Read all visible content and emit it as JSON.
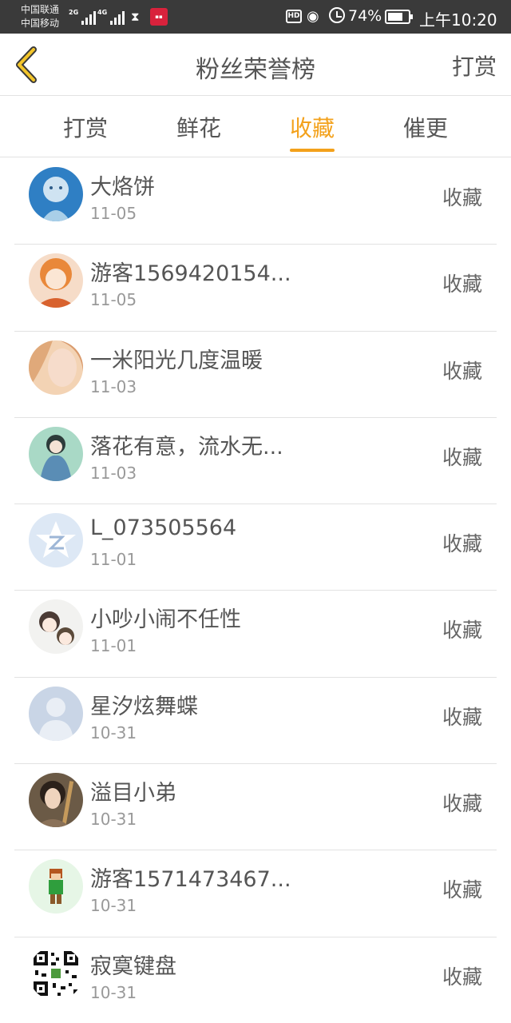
{
  "status_bar": {
    "carrier1": "中国联通",
    "carrier2": "中国移动",
    "net1": "2G",
    "net2": "4G",
    "hd": "HD",
    "battery": "74%",
    "time": "上午10:20"
  },
  "header": {
    "title": "粉丝荣誉榜",
    "action": "打赏",
    "accent": "#f3a11b"
  },
  "tabs": [
    {
      "label": "打赏",
      "active": false
    },
    {
      "label": "鲜花",
      "active": false
    },
    {
      "label": "收藏",
      "active": true
    },
    {
      "label": "催更",
      "active": false
    }
  ],
  "list": [
    {
      "name": "大烙饼",
      "date": "11-05",
      "action": "收藏",
      "avatar": "blue-doll-avatar"
    },
    {
      "name": "游客1569420154...",
      "date": "11-05",
      "action": "收藏",
      "avatar": "anime-girl-avatar"
    },
    {
      "name": "一米阳光几度温暖",
      "date": "11-03",
      "action": "收藏",
      "avatar": "blonde-girl-avatar"
    },
    {
      "name": "落花有意，流水无...",
      "date": "11-03",
      "action": "收藏",
      "avatar": "green-girl-avatar"
    },
    {
      "name": "L_073505564",
      "date": "11-01",
      "action": "收藏",
      "avatar": "qzone-star-avatar"
    },
    {
      "name": "小吵小闹不任性",
      "date": "11-01",
      "action": "收藏",
      "avatar": "couple-cartoon-avatar"
    },
    {
      "name": "星汐炫舞蝶",
      "date": "10-31",
      "action": "收藏",
      "avatar": "default-person-avatar"
    },
    {
      "name": "溢目小弟",
      "date": "10-31",
      "action": "收藏",
      "avatar": "guitar-man-avatar"
    },
    {
      "name": "游客1571473467...",
      "date": "10-31",
      "action": "收藏",
      "avatar": "pixel-character-avatar"
    },
    {
      "name": "寂寞键盘",
      "date": "10-31",
      "action": "收藏",
      "avatar": "qr-code-avatar"
    }
  ]
}
